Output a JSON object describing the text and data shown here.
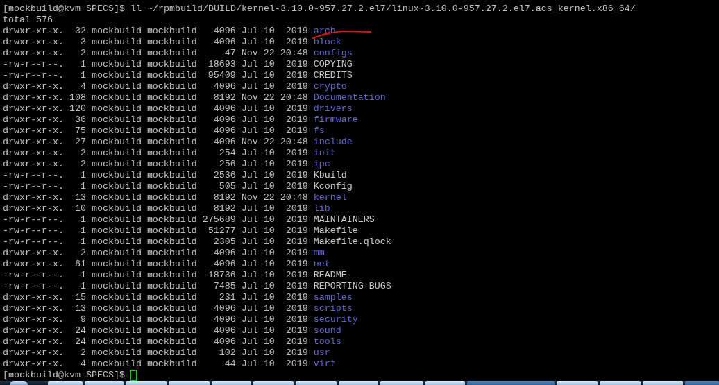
{
  "terminal": {
    "command_line": {
      "prompt": "[mockbuild@kvm SPECS]$",
      "command": "ll ~/rpmbuild/BUILD/kernel-3.10.0-957.27.2.el7/linux-3.10.0-957.27.2.el7.acs_kernel.x86_64/"
    },
    "total": "total 576",
    "listing": [
      {
        "permissions": "drwxr-xr-x.",
        "links": "32",
        "owner": "mockbuild",
        "group": "mockbuild",
        "size": "4096",
        "month": "Jul",
        "day": "10",
        "year_or_time": "2019",
        "name": "arch",
        "kind": "dir"
      },
      {
        "permissions": "drwxr-xr-x.",
        "links": "3",
        "owner": "mockbuild",
        "group": "mockbuild",
        "size": "4096",
        "month": "Jul",
        "day": "10",
        "year_or_time": "2019",
        "name": "block",
        "kind": "dir"
      },
      {
        "permissions": "drwxr-xr-x.",
        "links": "2",
        "owner": "mockbuild",
        "group": "mockbuild",
        "size": "47",
        "month": "Nov",
        "day": "22",
        "year_or_time": "20:48",
        "name": "configs",
        "kind": "dir"
      },
      {
        "permissions": "-rw-r--r--.",
        "links": "1",
        "owner": "mockbuild",
        "group": "mockbuild",
        "size": "18693",
        "month": "Jul",
        "day": "10",
        "year_or_time": "2019",
        "name": "COPYING",
        "kind": "file"
      },
      {
        "permissions": "-rw-r--r--.",
        "links": "1",
        "owner": "mockbuild",
        "group": "mockbuild",
        "size": "95409",
        "month": "Jul",
        "day": "10",
        "year_or_time": "2019",
        "name": "CREDITS",
        "kind": "file"
      },
      {
        "permissions": "drwxr-xr-x.",
        "links": "4",
        "owner": "mockbuild",
        "group": "mockbuild",
        "size": "4096",
        "month": "Jul",
        "day": "10",
        "year_or_time": "2019",
        "name": "crypto",
        "kind": "dir"
      },
      {
        "permissions": "drwxr-xr-x.",
        "links": "108",
        "owner": "mockbuild",
        "group": "mockbuild",
        "size": "8192",
        "month": "Nov",
        "day": "22",
        "year_or_time": "20:48",
        "name": "Documentation",
        "kind": "dir"
      },
      {
        "permissions": "drwxr-xr-x.",
        "links": "120",
        "owner": "mockbuild",
        "group": "mockbuild",
        "size": "4096",
        "month": "Jul",
        "day": "10",
        "year_or_time": "2019",
        "name": "drivers",
        "kind": "dir"
      },
      {
        "permissions": "drwxr-xr-x.",
        "links": "36",
        "owner": "mockbuild",
        "group": "mockbuild",
        "size": "4096",
        "month": "Jul",
        "day": "10",
        "year_or_time": "2019",
        "name": "firmware",
        "kind": "dir"
      },
      {
        "permissions": "drwxr-xr-x.",
        "links": "75",
        "owner": "mockbuild",
        "group": "mockbuild",
        "size": "4096",
        "month": "Jul",
        "day": "10",
        "year_or_time": "2019",
        "name": "fs",
        "kind": "dir"
      },
      {
        "permissions": "drwxr-xr-x.",
        "links": "27",
        "owner": "mockbuild",
        "group": "mockbuild",
        "size": "4096",
        "month": "Nov",
        "day": "22",
        "year_or_time": "20:48",
        "name": "include",
        "kind": "dir"
      },
      {
        "permissions": "drwxr-xr-x.",
        "links": "2",
        "owner": "mockbuild",
        "group": "mockbuild",
        "size": "254",
        "month": "Jul",
        "day": "10",
        "year_or_time": "2019",
        "name": "init",
        "kind": "dir"
      },
      {
        "permissions": "drwxr-xr-x.",
        "links": "2",
        "owner": "mockbuild",
        "group": "mockbuild",
        "size": "256",
        "month": "Jul",
        "day": "10",
        "year_or_time": "2019",
        "name": "ipc",
        "kind": "dir"
      },
      {
        "permissions": "-rw-r--r--.",
        "links": "1",
        "owner": "mockbuild",
        "group": "mockbuild",
        "size": "2536",
        "month": "Jul",
        "day": "10",
        "year_or_time": "2019",
        "name": "Kbuild",
        "kind": "file"
      },
      {
        "permissions": "-rw-r--r--.",
        "links": "1",
        "owner": "mockbuild",
        "group": "mockbuild",
        "size": "505",
        "month": "Jul",
        "day": "10",
        "year_or_time": "2019",
        "name": "Kconfig",
        "kind": "file"
      },
      {
        "permissions": "drwxr-xr-x.",
        "links": "13",
        "owner": "mockbuild",
        "group": "mockbuild",
        "size": "8192",
        "month": "Nov",
        "day": "22",
        "year_or_time": "20:48",
        "name": "kernel",
        "kind": "dir"
      },
      {
        "permissions": "drwxr-xr-x.",
        "links": "10",
        "owner": "mockbuild",
        "group": "mockbuild",
        "size": "8192",
        "month": "Jul",
        "day": "10",
        "year_or_time": "2019",
        "name": "lib",
        "kind": "dir"
      },
      {
        "permissions": "-rw-r--r--.",
        "links": "1",
        "owner": "mockbuild",
        "group": "mockbuild",
        "size": "275689",
        "month": "Jul",
        "day": "10",
        "year_or_time": "2019",
        "name": "MAINTAINERS",
        "kind": "file"
      },
      {
        "permissions": "-rw-r--r--.",
        "links": "1",
        "owner": "mockbuild",
        "group": "mockbuild",
        "size": "51277",
        "month": "Jul",
        "day": "10",
        "year_or_time": "2019",
        "name": "Makefile",
        "kind": "file"
      },
      {
        "permissions": "-rw-r--r--.",
        "links": "1",
        "owner": "mockbuild",
        "group": "mockbuild",
        "size": "2305",
        "month": "Jul",
        "day": "10",
        "year_or_time": "2019",
        "name": "Makefile.qlock",
        "kind": "file"
      },
      {
        "permissions": "drwxr-xr-x.",
        "links": "2",
        "owner": "mockbuild",
        "group": "mockbuild",
        "size": "4096",
        "month": "Jul",
        "day": "10",
        "year_or_time": "2019",
        "name": "mm",
        "kind": "dir"
      },
      {
        "permissions": "drwxr-xr-x.",
        "links": "61",
        "owner": "mockbuild",
        "group": "mockbuild",
        "size": "4096",
        "month": "Jul",
        "day": "10",
        "year_or_time": "2019",
        "name": "net",
        "kind": "dir"
      },
      {
        "permissions": "-rw-r--r--.",
        "links": "1",
        "owner": "mockbuild",
        "group": "mockbuild",
        "size": "18736",
        "month": "Jul",
        "day": "10",
        "year_or_time": "2019",
        "name": "README",
        "kind": "file"
      },
      {
        "permissions": "-rw-r--r--.",
        "links": "1",
        "owner": "mockbuild",
        "group": "mockbuild",
        "size": "7485",
        "month": "Jul",
        "day": "10",
        "year_or_time": "2019",
        "name": "REPORTING-BUGS",
        "kind": "file"
      },
      {
        "permissions": "drwxr-xr-x.",
        "links": "15",
        "owner": "mockbuild",
        "group": "mockbuild",
        "size": "231",
        "month": "Jul",
        "day": "10",
        "year_or_time": "2019",
        "name": "samples",
        "kind": "dir"
      },
      {
        "permissions": "drwxr-xr-x.",
        "links": "13",
        "owner": "mockbuild",
        "group": "mockbuild",
        "size": "4096",
        "month": "Jul",
        "day": "10",
        "year_or_time": "2019",
        "name": "scripts",
        "kind": "dir"
      },
      {
        "permissions": "drwxr-xr-x.",
        "links": "9",
        "owner": "mockbuild",
        "group": "mockbuild",
        "size": "4096",
        "month": "Jul",
        "day": "10",
        "year_or_time": "2019",
        "name": "security",
        "kind": "dir"
      },
      {
        "permissions": "drwxr-xr-x.",
        "links": "24",
        "owner": "mockbuild",
        "group": "mockbuild",
        "size": "4096",
        "month": "Jul",
        "day": "10",
        "year_or_time": "2019",
        "name": "sound",
        "kind": "dir"
      },
      {
        "permissions": "drwxr-xr-x.",
        "links": "24",
        "owner": "mockbuild",
        "group": "mockbuild",
        "size": "4096",
        "month": "Jul",
        "day": "10",
        "year_or_time": "2019",
        "name": "tools",
        "kind": "dir"
      },
      {
        "permissions": "drwxr-xr-x.",
        "links": "2",
        "owner": "mockbuild",
        "group": "mockbuild",
        "size": "102",
        "month": "Jul",
        "day": "10",
        "year_or_time": "2019",
        "name": "usr",
        "kind": "dir"
      },
      {
        "permissions": "drwxr-xr-x.",
        "links": "4",
        "owner": "mockbuild",
        "group": "mockbuild",
        "size": "44",
        "month": "Jul",
        "day": "10",
        "year_or_time": "2019",
        "name": "virt",
        "kind": "dir"
      }
    ],
    "final_prompt": {
      "prompt": "[mockbuild@kvm SPECS]$"
    }
  }
}
